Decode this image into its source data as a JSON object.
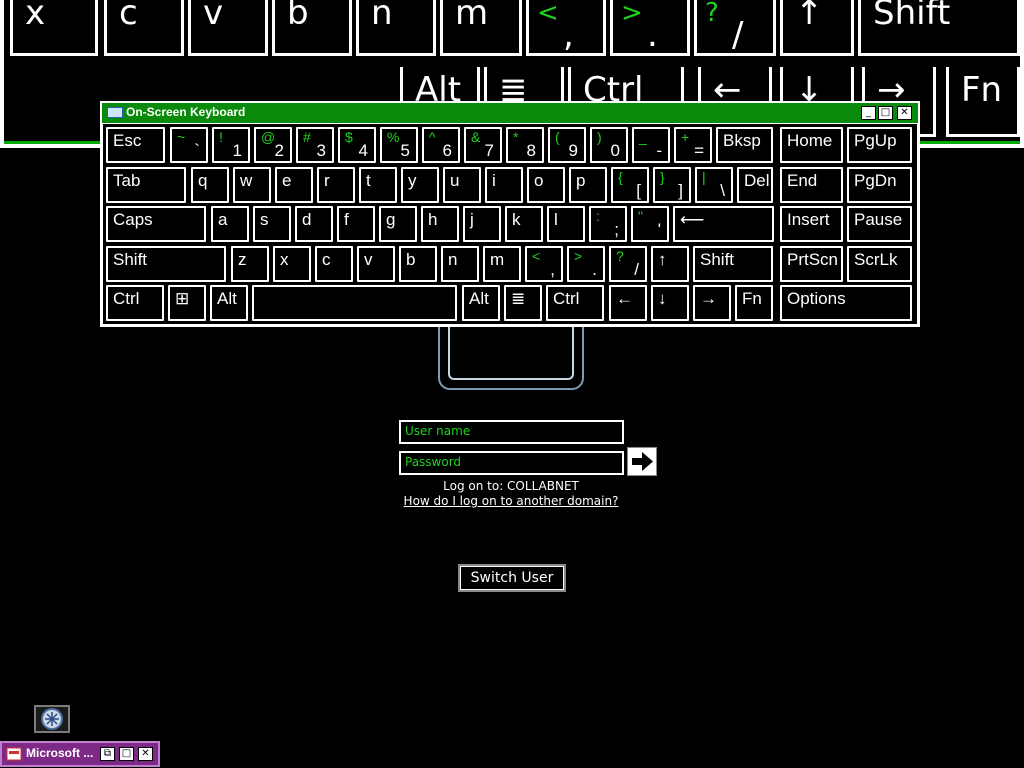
{
  "background_keyboard": {
    "row1": [
      {
        "low": "x"
      },
      {
        "low": "c"
      },
      {
        "low": "v"
      },
      {
        "low": "b"
      },
      {
        "low": "n"
      },
      {
        "low": "m"
      },
      {
        "up": "<",
        "low": ","
      },
      {
        "up": ">",
        "low": "."
      },
      {
        "up": "?",
        "low": "/"
      },
      {
        "low": "↑"
      },
      {
        "low": "Shift"
      }
    ],
    "row2": [
      {
        "low": "Alt"
      },
      {
        "low": "≣"
      },
      {
        "low": "Ctrl"
      },
      {
        "low": "←"
      },
      {
        "low": "↓"
      },
      {
        "low": "→"
      },
      {
        "low": "Fn"
      }
    ]
  },
  "osk": {
    "title": "On-Screen Keyboard",
    "buttons": {
      "minimize": "_",
      "restore": "□",
      "close": "✕"
    },
    "rows": [
      [
        {
          "main": "Esc"
        },
        {
          "up": "~",
          "low": "`"
        },
        {
          "up": "!",
          "low": "1"
        },
        {
          "up": "@",
          "low": "2"
        },
        {
          "up": "#",
          "low": "3"
        },
        {
          "up": "$",
          "low": "4"
        },
        {
          "up": "%",
          "low": "5"
        },
        {
          "up": "^",
          "low": "6"
        },
        {
          "up": "&",
          "low": "7"
        },
        {
          "up": "*",
          "low": "8"
        },
        {
          "up": "(",
          "low": "9"
        },
        {
          "up": ")",
          "low": "0"
        },
        {
          "up": "_",
          "low": "-"
        },
        {
          "up": "+",
          "low": "="
        },
        {
          "main": "Bksp"
        },
        {
          "main": "Home"
        },
        {
          "main": "PgUp"
        }
      ],
      [
        {
          "main": "Tab"
        },
        {
          "main": "q"
        },
        {
          "main": "w"
        },
        {
          "main": "e"
        },
        {
          "main": "r"
        },
        {
          "main": "t"
        },
        {
          "main": "y"
        },
        {
          "main": "u"
        },
        {
          "main": "i"
        },
        {
          "main": "o"
        },
        {
          "main": "p"
        },
        {
          "up": "{",
          "low": "["
        },
        {
          "up": "}",
          "low": "]"
        },
        {
          "up": "|",
          "low": "\\"
        },
        {
          "main": "Del"
        },
        {
          "main": "End"
        },
        {
          "main": "PgDn"
        }
      ],
      [
        {
          "main": "Caps"
        },
        {
          "main": "a"
        },
        {
          "main": "s"
        },
        {
          "main": "d"
        },
        {
          "main": "f"
        },
        {
          "main": "g"
        },
        {
          "main": "h"
        },
        {
          "main": "j"
        },
        {
          "main": "k"
        },
        {
          "main": "l"
        },
        {
          "up": ":",
          "low": ";"
        },
        {
          "up": "\"",
          "low": "'"
        },
        {
          "main": "⟵"
        },
        {
          "main": "Insert"
        },
        {
          "main": "Pause"
        }
      ],
      [
        {
          "main": "Shift"
        },
        {
          "main": "z"
        },
        {
          "main": "x"
        },
        {
          "main": "c"
        },
        {
          "main": "v"
        },
        {
          "main": "b"
        },
        {
          "main": "n"
        },
        {
          "main": "m"
        },
        {
          "up": "<",
          "low": ","
        },
        {
          "up": ">",
          "low": "."
        },
        {
          "up": "?",
          "low": "/"
        },
        {
          "main": "↑"
        },
        {
          "main": "Shift"
        },
        {
          "main": "PrtScn"
        },
        {
          "main": "ScrLk"
        }
      ],
      [
        {
          "main": "Ctrl"
        },
        {
          "main": "⊞"
        },
        {
          "main": "Alt"
        },
        {
          "main": ""
        },
        {
          "main": "Alt"
        },
        {
          "main": "≣"
        },
        {
          "main": "Ctrl"
        },
        {
          "main": "←"
        },
        {
          "main": "↓"
        },
        {
          "main": "→"
        },
        {
          "main": "Fn"
        },
        {
          "main": "Options"
        }
      ]
    ]
  },
  "logon": {
    "username_placeholder": "User name",
    "password_placeholder": "Password",
    "log_on_to": "Log on to: COLLABNET",
    "other_domain_link": "How do I log on to another domain?",
    "switch_user": "Switch User"
  },
  "taskbar": {
    "item_label": "Microsoft ...",
    "buttons": {
      "restore": "⧉",
      "maximize": "□",
      "close": "✕"
    }
  },
  "colors": {
    "accent_green": "#1fd31f",
    "title_green": "#0a8a0a",
    "taskbar_purple": "#7c2a86"
  }
}
